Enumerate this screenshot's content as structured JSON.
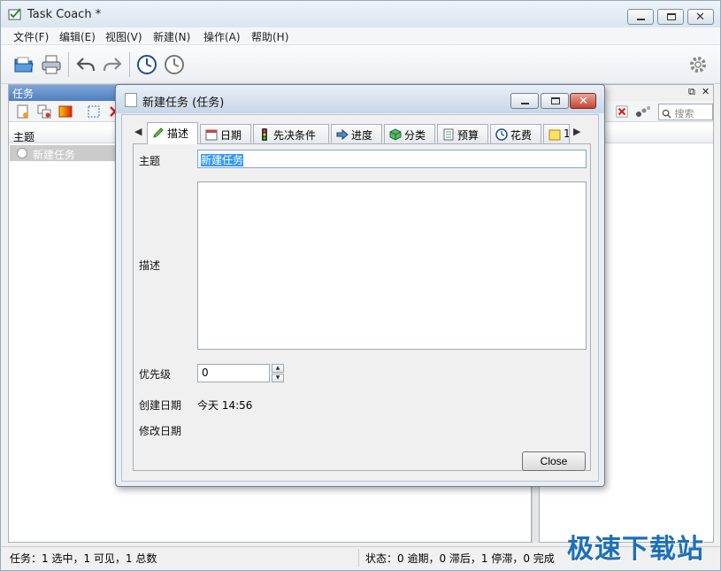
{
  "app": {
    "title": "Task Coach *"
  },
  "menu": [
    {
      "label": "文件(F)"
    },
    {
      "label": "编辑(E)"
    },
    {
      "label": "视图(V)"
    },
    {
      "label": "新建(N)"
    },
    {
      "label": "操作(A)"
    },
    {
      "label": "帮助(H)"
    }
  ],
  "task_panel": {
    "header": "任务",
    "column_header": "主题",
    "rows": [
      {
        "title": "新建任务"
      }
    ]
  },
  "right_panel": {
    "search_placeholder": "搜索",
    "float_glyph": "⧉",
    "close_glyph": "✕"
  },
  "statusbar": {
    "left": "任务：1 选中，1 可见，1 总数",
    "right": "状态：0 逾期，0 滞后，1 停滞，0 完成"
  },
  "watermark": "极速下载站",
  "dialog": {
    "title": "新建任务 (任务)",
    "tabs": [
      {
        "label": "描述",
        "icon": "pencil-icon",
        "active": true
      },
      {
        "label": "日期",
        "icon": "calendar-icon"
      },
      {
        "label": "先决条件",
        "icon": "traffic-light-icon"
      },
      {
        "label": "进度",
        "icon": "progress-arrow-icon"
      },
      {
        "label": "分类",
        "icon": "category-box-icon"
      },
      {
        "label": "预算",
        "icon": "budget-sheet-icon"
      },
      {
        "label": "花费",
        "icon": "clock-icon"
      },
      {
        "label": "1",
        "icon": "note-icon"
      }
    ],
    "fields": {
      "subject_label": "主题",
      "subject_value": "新建任务",
      "description_label": "描述",
      "priority_label": "优先级",
      "priority_value": "0",
      "created_label": "创建日期",
      "created_value": "今天 14:56",
      "modified_label": "修改日期"
    },
    "close_button": "Close"
  },
  "colors": {
    "panel_header": "#4f7fc0",
    "selection": "#3399ff",
    "watermark": "#1d6fb8",
    "dialog_close": "#c5452f"
  }
}
